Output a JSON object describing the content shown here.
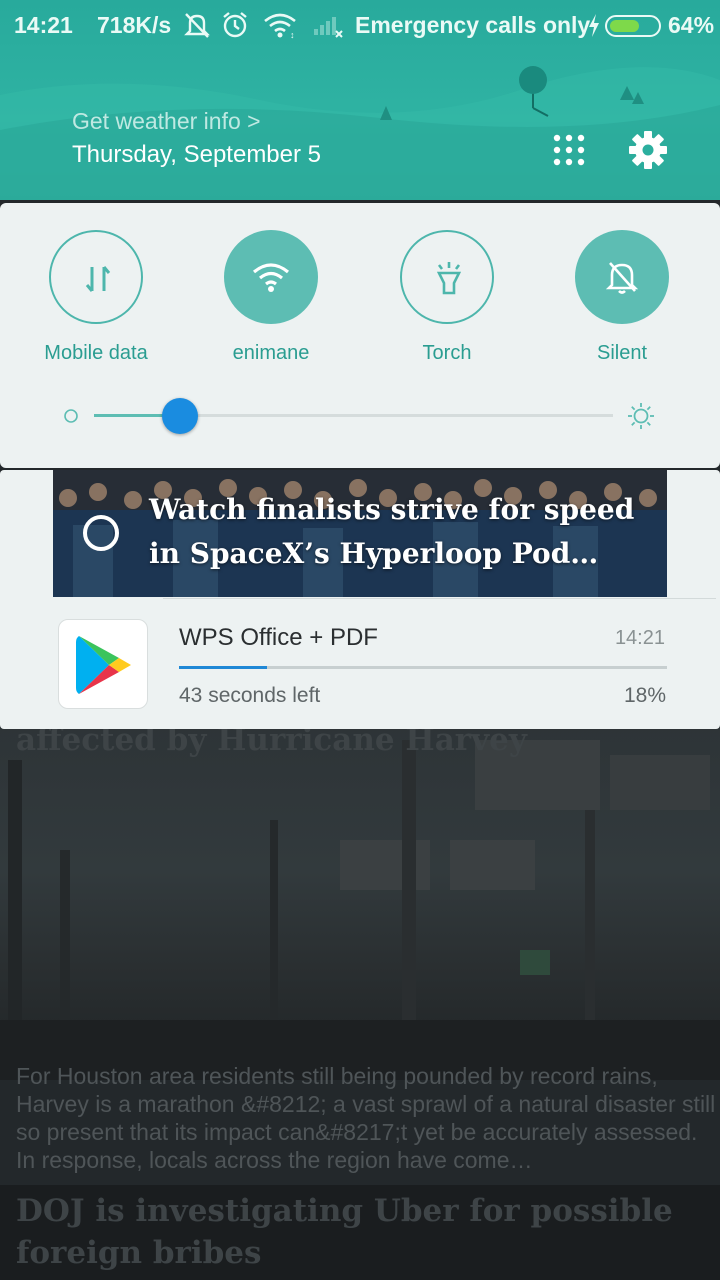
{
  "status_bar": {
    "time": "14:21",
    "speed": "718K/s",
    "carrier": "Emergency calls only",
    "battery": "64%",
    "battery_level": 0.64,
    "icons": [
      "silent-bell-icon",
      "alarm-icon",
      "wifi-icon",
      "signal-none-icon",
      "charging-bolt-icon",
      "battery-icon"
    ]
  },
  "header": {
    "weather_link": "Get weather info >",
    "date": "Thursday, September 5",
    "icons": [
      "grid-apps-icon",
      "settings-gear-icon"
    ]
  },
  "quick_settings": {
    "toggles": [
      {
        "label": "Mobile data",
        "icon": "mobile-data-icon",
        "active": false
      },
      {
        "label": "enimane",
        "icon": "wifi-icon",
        "active": true
      },
      {
        "label": "Torch",
        "icon": "torch-icon",
        "active": false
      },
      {
        "label": "Silent",
        "icon": "silent-bell-icon",
        "active": true
      }
    ],
    "brightness_level": 0.165
  },
  "notifications": {
    "news": {
      "headline": "Watch finalists strive for speed in SpaceX’s Hyperloop Pod…"
    },
    "download": {
      "title": "WPS Office + PDF",
      "time": "14:21",
      "remaining": "43 seconds left",
      "percent_text": "18%",
      "progress": 0.18,
      "app_icon": "google-play-icon"
    }
  },
  "background_app": {
    "headline_1": "affected by Hurricane Harvey",
    "snippet": "For Houston area residents still being pounded by record rains, Harvey is a marathon &#8212; a vast sprawl of a natural disaster still so present that its impact can&#8217;t yet be accurately assessed. In response, locals across the region have come…",
    "headline_2": "DOJ is investigating Uber for possible foreign bribes"
  }
}
